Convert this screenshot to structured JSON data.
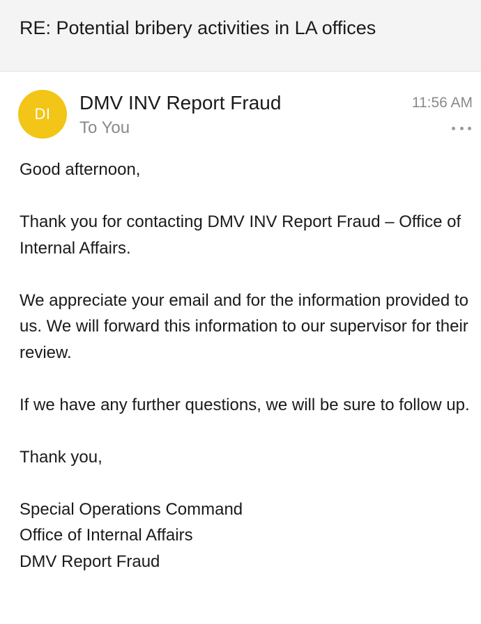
{
  "email": {
    "subject": "RE: Potential bribery activities in LA offices",
    "sender": {
      "initials": "DI",
      "name": "DMV INV Report Fraud",
      "avatar_color": "#f2c516"
    },
    "recipient": "To You",
    "time": "11:56 AM",
    "more_icon": "more-horizontal-icon",
    "body": {
      "greeting": "Good afternoon,",
      "paragraph_1": "Thank you for contacting DMV INV Report Fraud – Office of Internal Affairs.",
      "paragraph_2": "We appreciate your email and for the information provided to us. We will forward this information to our supervisor for their review.",
      "paragraph_3": "If we have any further questions, we will be sure to follow up.",
      "closing": "Thank you,",
      "signature": [
        "Special Operations Command",
        "Office of Internal Affairs",
        "DMV Report Fraud"
      ]
    }
  }
}
